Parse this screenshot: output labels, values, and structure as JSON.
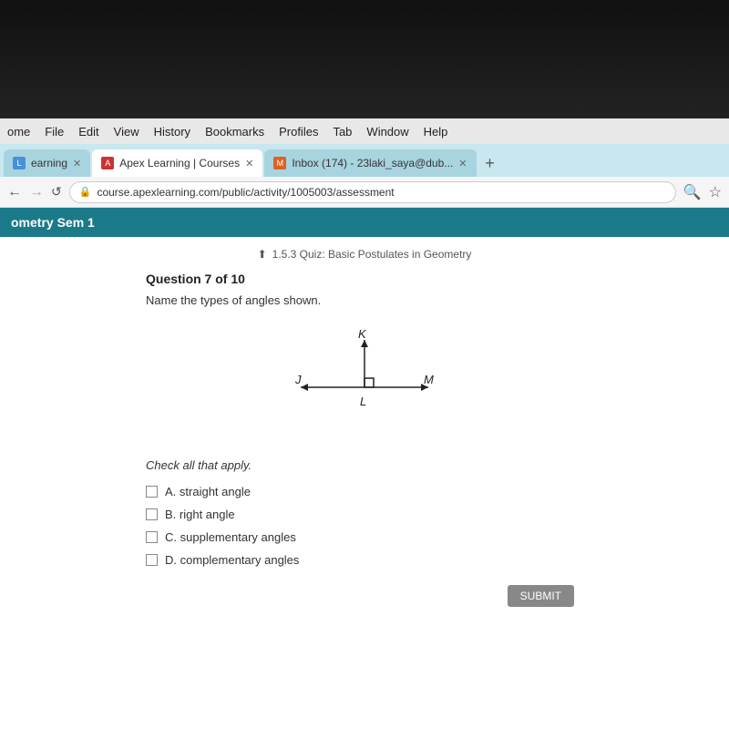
{
  "dark_top": {
    "height": 130
  },
  "menu_bar": {
    "items": [
      "ome",
      "File",
      "Edit",
      "View",
      "History",
      "Bookmarks",
      "Profiles",
      "Tab",
      "Window",
      "Help"
    ]
  },
  "tab_bar": {
    "tabs": [
      {
        "id": "tab-learning",
        "label": "earning",
        "active": false,
        "favicon": "L"
      },
      {
        "id": "tab-apex",
        "label": "Apex Learning | Courses",
        "active": true,
        "favicon": "A"
      },
      {
        "id": "tab-inbox",
        "label": "Inbox (174) - 23laki_saya@dub...",
        "active": false,
        "favicon": "M"
      }
    ],
    "add_label": "+"
  },
  "address_bar": {
    "url": "course.apexlearning.com/public/activity/1005003/assessment",
    "lock_icon": "🔒"
  },
  "breadcrumb": {
    "title": "ometry Sem 1"
  },
  "quiz": {
    "label": "1.5.3 Quiz:  Basic Postulates in Geometry",
    "question_number": "Question 7 of 10",
    "question_text": "Name the types of angles shown.",
    "check_all": "Check all that apply.",
    "options": [
      {
        "id": "A",
        "label": "straight angle"
      },
      {
        "id": "B",
        "label": "right angle"
      },
      {
        "id": "C",
        "label": "supplementary angles"
      },
      {
        "id": "D",
        "label": "complementary angles"
      }
    ],
    "submit_label": "SUBMIT"
  }
}
